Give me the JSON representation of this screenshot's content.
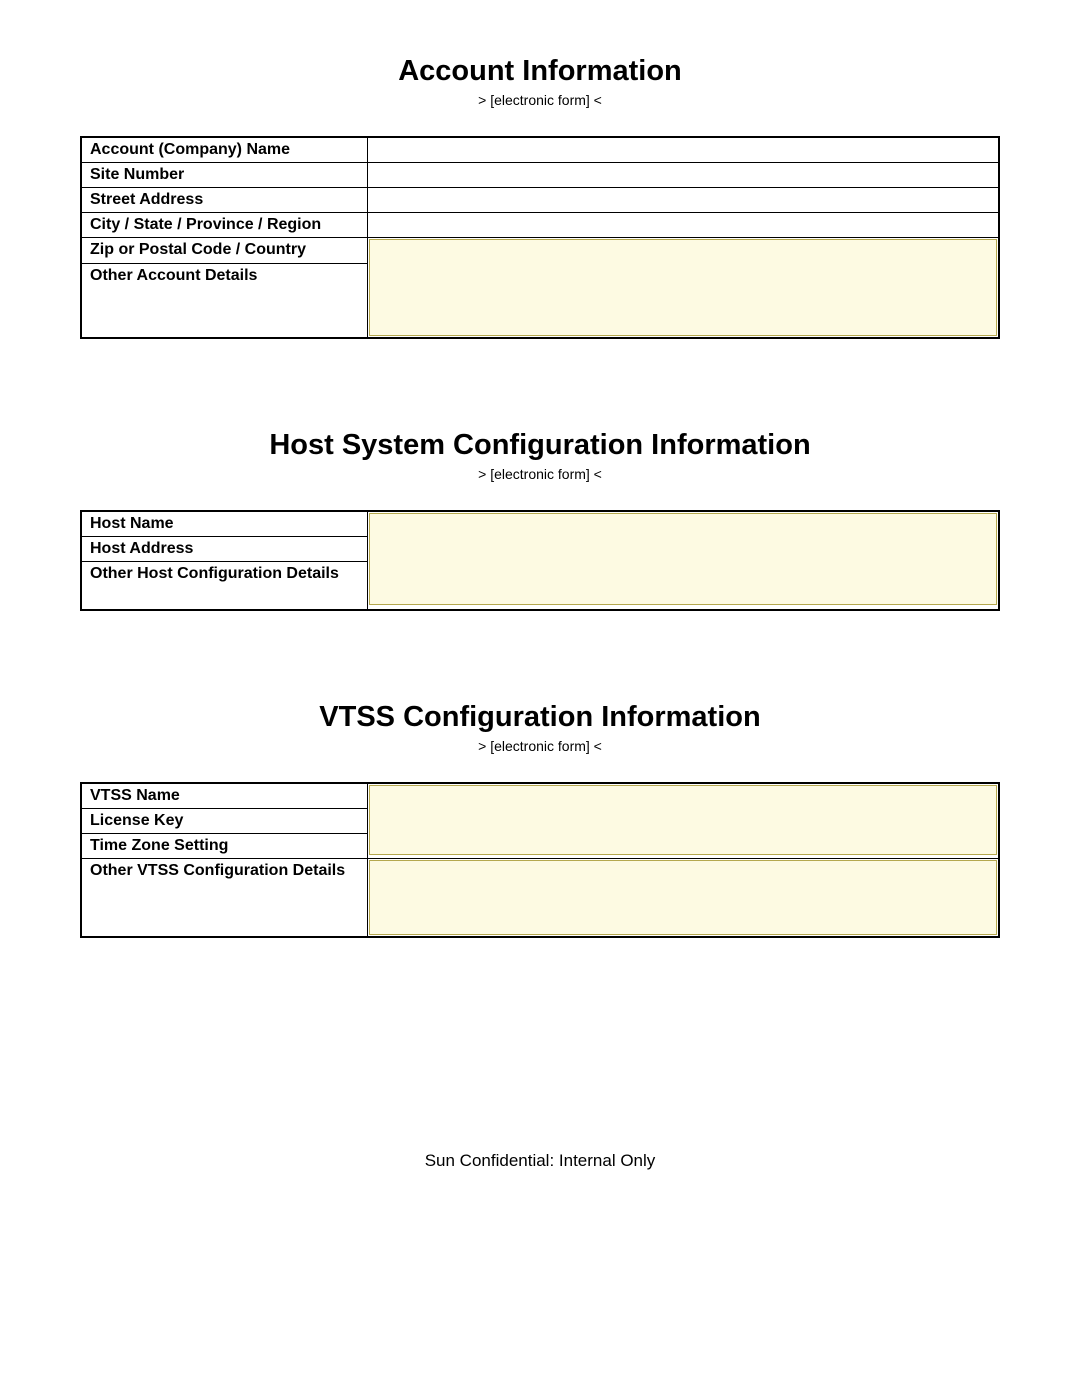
{
  "footer": "Sun Confidential: Internal Only",
  "subtitle": "> [electronic form] <",
  "sections": {
    "account": {
      "title": "Account Information",
      "rows": {
        "company": "Account (Company) Name",
        "site": "Site Number",
        "street": "Street Address",
        "city": "City / State / Province / Region",
        "zip": "Zip or Postal Code / Country",
        "other": "Other Account Details"
      }
    },
    "host": {
      "title": "Host System Configuration Information",
      "rows": {
        "name": "Host Name",
        "address": "Host Address",
        "other": "Other Host Configuration Details"
      }
    },
    "vtss": {
      "title": "VTSS Configuration Information",
      "rows": {
        "name": "VTSS Name",
        "license": "License Key",
        "tz": "Time Zone Setting",
        "other": "Other VTSS Configuration Details"
      }
    }
  }
}
